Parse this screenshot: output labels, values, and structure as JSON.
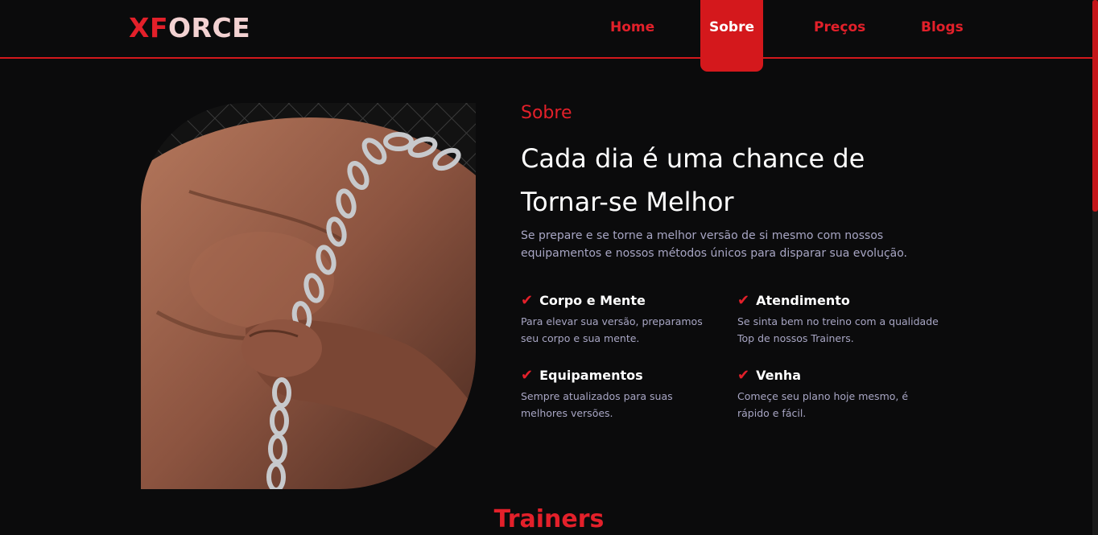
{
  "brand": {
    "accent": "XF",
    "rest": "ORCE"
  },
  "nav": {
    "items": [
      {
        "label": "Home",
        "active": false
      },
      {
        "label": "Sobre",
        "active": true
      },
      {
        "label": "Preços",
        "active": false
      },
      {
        "label": "Blogs",
        "active": false
      }
    ]
  },
  "about": {
    "eyebrow": "Sobre",
    "headline_line1": "Cada dia é uma chance de",
    "headline_line2": "Tornar-se Melhor",
    "description": "Se prepare e se torne a melhor versão de si mesmo com nossos equipamentos e nossos métodos únicos para disparar sua evolução.",
    "features": [
      {
        "title": "Corpo e Mente",
        "text": "Para elevar sua versão, preparamos seu corpo e sua mente.",
        "icon": "check-icon"
      },
      {
        "title": "Atendimento",
        "text": "Se sinta bem no treino com a qualidade Top de nossos Trainers.",
        "icon": "check-icon"
      },
      {
        "title": "Equipamentos",
        "text": "Sempre atualizados para suas melhores versões.",
        "icon": "check-icon"
      },
      {
        "title": "Venha",
        "text": "Começe seu plano hoje mesmo, é rápido e fácil.",
        "icon": "check-icon"
      }
    ]
  },
  "trainers": {
    "title": "Trainers"
  },
  "colors": {
    "accent": "#e3202a",
    "background": "#0b0b0c",
    "muted_text": "#a8a6c4"
  }
}
